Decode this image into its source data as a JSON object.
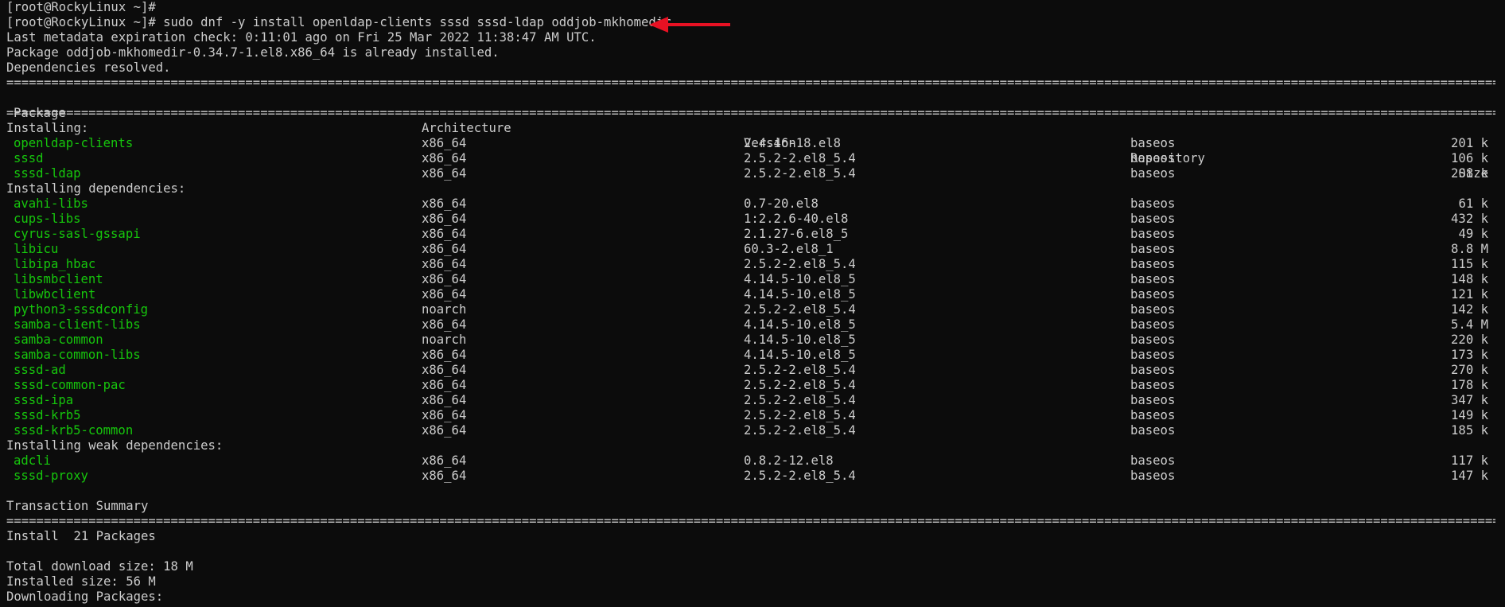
{
  "terminal": {
    "prompt1": "[root@RockyLinux ~]#",
    "prompt2": "[root@RockyLinux ~]# sudo dnf -y install openldap-clients sssd sssd-ldap oddjob-mkhomedir",
    "meta": "Last metadata expiration check: 0:11:01 ago on Fri 25 Mar 2022 11:38:47 AM UTC.",
    "already": "Package oddjob-mkhomedir-0.34.7-1.el8.x86_64 is already installed.",
    "deps": "Dependencies resolved.",
    "separator": "================================================================================================================================================================================================================================================================================================",
    "headers": {
      "package": "Package",
      "arch": "Architecture",
      "version": "Version",
      "repo": "Repository",
      "size": "Size"
    },
    "section_installing": "Installing:",
    "installing": [
      {
        "name": "openldap-clients",
        "arch": "x86_64",
        "version": "2.4.46-18.el8",
        "repo": "baseos",
        "size": "201 k"
      },
      {
        "name": "sssd",
        "arch": "x86_64",
        "version": "2.5.2-2.el8_5.4",
        "repo": "baseos",
        "size": "106 k"
      },
      {
        "name": "sssd-ldap",
        "arch": "x86_64",
        "version": "2.5.2-2.el8_5.4",
        "repo": "baseos",
        "size": "208 k"
      }
    ],
    "section_deps": "Installing dependencies:",
    "dependencies": [
      {
        "name": "avahi-libs",
        "arch": "x86_64",
        "version": "0.7-20.el8",
        "repo": "baseos",
        "size": "61 k"
      },
      {
        "name": "cups-libs",
        "arch": "x86_64",
        "version": "1:2.2.6-40.el8",
        "repo": "baseos",
        "size": "432 k"
      },
      {
        "name": "cyrus-sasl-gssapi",
        "arch": "x86_64",
        "version": "2.1.27-6.el8_5",
        "repo": "baseos",
        "size": "49 k"
      },
      {
        "name": "libicu",
        "arch": "x86_64",
        "version": "60.3-2.el8_1",
        "repo": "baseos",
        "size": "8.8 M"
      },
      {
        "name": "libipa_hbac",
        "arch": "x86_64",
        "version": "2.5.2-2.el8_5.4",
        "repo": "baseos",
        "size": "115 k"
      },
      {
        "name": "libsmbclient",
        "arch": "x86_64",
        "version": "4.14.5-10.el8_5",
        "repo": "baseos",
        "size": "148 k"
      },
      {
        "name": "libwbclient",
        "arch": "x86_64",
        "version": "4.14.5-10.el8_5",
        "repo": "baseos",
        "size": "121 k"
      },
      {
        "name": "python3-sssdconfig",
        "arch": "noarch",
        "version": "2.5.2-2.el8_5.4",
        "repo": "baseos",
        "size": "142 k"
      },
      {
        "name": "samba-client-libs",
        "arch": "x86_64",
        "version": "4.14.5-10.el8_5",
        "repo": "baseos",
        "size": "5.4 M"
      },
      {
        "name": "samba-common",
        "arch": "noarch",
        "version": "4.14.5-10.el8_5",
        "repo": "baseos",
        "size": "220 k"
      },
      {
        "name": "samba-common-libs",
        "arch": "x86_64",
        "version": "4.14.5-10.el8_5",
        "repo": "baseos",
        "size": "173 k"
      },
      {
        "name": "sssd-ad",
        "arch": "x86_64",
        "version": "2.5.2-2.el8_5.4",
        "repo": "baseos",
        "size": "270 k"
      },
      {
        "name": "sssd-common-pac",
        "arch": "x86_64",
        "version": "2.5.2-2.el8_5.4",
        "repo": "baseos",
        "size": "178 k"
      },
      {
        "name": "sssd-ipa",
        "arch": "x86_64",
        "version": "2.5.2-2.el8_5.4",
        "repo": "baseos",
        "size": "347 k"
      },
      {
        "name": "sssd-krb5",
        "arch": "x86_64",
        "version": "2.5.2-2.el8_5.4",
        "repo": "baseos",
        "size": "149 k"
      },
      {
        "name": "sssd-krb5-common",
        "arch": "x86_64",
        "version": "2.5.2-2.el8_5.4",
        "repo": "baseos",
        "size": "185 k"
      }
    ],
    "section_weak": "Installing weak dependencies:",
    "weak": [
      {
        "name": "adcli",
        "arch": "x86_64",
        "version": "0.8.2-12.el8",
        "repo": "baseos",
        "size": "117 k"
      },
      {
        "name": "sssd-proxy",
        "arch": "x86_64",
        "version": "2.5.2-2.el8_5.4",
        "repo": "baseos",
        "size": "147 k"
      }
    ],
    "summary_title": "Transaction Summary",
    "install_count": "Install  21 Packages",
    "download_size": "Total download size: 18 M",
    "installed_size": "Installed size: 56 M",
    "downloading": "Downloading Packages:"
  },
  "colors": {
    "background": "#0c0c0c",
    "text": "#cccccc",
    "package": "#16c60c",
    "arrow": "#e81123"
  }
}
